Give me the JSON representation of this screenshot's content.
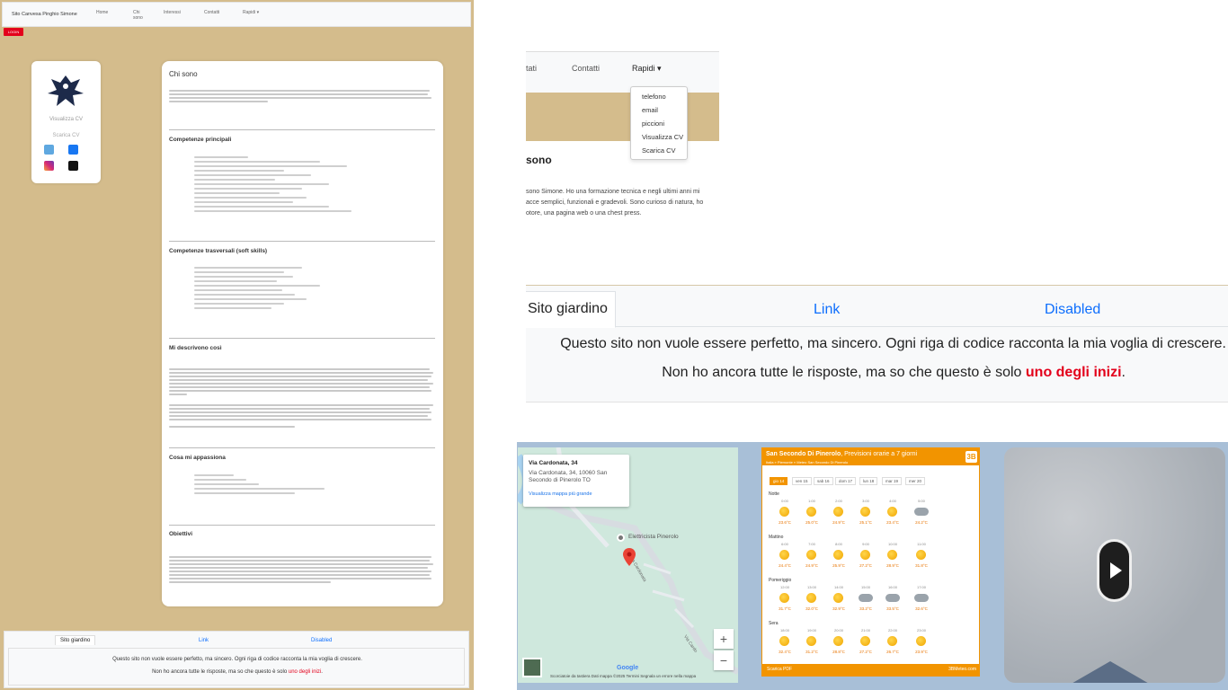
{
  "thumb": {
    "nav": {
      "brand": "Sito Canvesa Pinghio Simone",
      "links": [
        "Home",
        "Chi sono",
        "Interessi",
        "Contatti",
        "Rapidi ▾"
      ]
    },
    "red_button": "LOGIN",
    "profile": {
      "caption": "Visualizza CV",
      "download": "Scarica CV"
    },
    "main": {
      "sections": [
        "Chi sono",
        "Competenze principali",
        "Competenze trasversali (soft skills)",
        "Mi descrivono così",
        "Cosa mi appassiona",
        "Obiettivi"
      ]
    },
    "footer": {
      "tabs": [
        "Sito giardino",
        "Link",
        "Disabled"
      ],
      "line1": "Questo sito non vuole essere perfetto, ma sincero. Ogni riga di codice racconta la mia voglia di crescere.",
      "line2_prefix": "Non ho ancora tutte le risposte, ma so che questo è solo ",
      "line2_highlight": "uno degli inizi",
      "line2_suffix": "."
    }
  },
  "nav_zoom": {
    "items": [
      "tati",
      "Contatti",
      "Rapidi ▾"
    ],
    "dropdown": [
      "telefono",
      "email",
      "piccioni",
      "Visualizza CV",
      "Scarica CV"
    ],
    "heading": "sono",
    "para": [
      "sono Simone. Ho una formazione tecnica e negli ultimi anni mi",
      "acce semplici, funzionali e gradevoli. Sono curioso di natura, ho",
      "otore, una pagina web o una chest press."
    ]
  },
  "footer_zoom": {
    "tab_active": "Sito giardino",
    "tab_link": "Link",
    "tab_disabled": "Disabled",
    "line1": "Questo sito non vuole essere perfetto, ma sincero. Ogni riga di codice racconta la mia voglia di crescere.",
    "line2_prefix": "Non ho ancora tutte le risposte, ma so che questo è solo ",
    "line2_highlight": "uno degli inizi",
    "line2_suffix": "."
  },
  "map": {
    "title": "Via Cardonata, 34",
    "address1": "Via Cardonata, 34, 10060 San",
    "address2": "Secondo di Pinerolo TO",
    "link": "Visualizza mappa più grande",
    "poi": "Elettricista Pinerolo",
    "road1": "Via Cardonata",
    "road2": "Via Cardo",
    "zoom_in": "+",
    "zoom_out": "−",
    "google": "Google",
    "attribution": "Scorciatoie da tastiera   Dati mappa ©2025   Termini   Segnala un errore nella mappa"
  },
  "weather": {
    "title": "San Secondo Di Pinerolo",
    "subtitle": "Previsioni orarie a 7 giorni",
    "breadcrumb": "Italia  »  Piemonte  »  Meteo San Secondo Di Pinerolo",
    "logo": "3B",
    "days": [
      "gio 14",
      "ven 15",
      "sab 16",
      "dom 17",
      "lun 18",
      "mar 19",
      "mer 20"
    ],
    "bands": [
      {
        "name": "Notte",
        "hours": [
          "0:00",
          "1:00",
          "2:00",
          "3:00",
          "4:00",
          "5:00"
        ],
        "temps": [
          "23.6°C",
          "25.0°C",
          "24.9°C",
          "25.1°C",
          "23.4°C",
          "24.2°C"
        ],
        "icons": [
          "sun",
          "sun",
          "sun",
          "sun",
          "sun",
          "cloud"
        ]
      },
      {
        "name": "Mattino",
        "hours": [
          "6:00",
          "7:00",
          "8:00",
          "9:00",
          "10:00",
          "11:00"
        ],
        "temps": [
          "24.4°C",
          "24.9°C",
          "25.9°C",
          "27.2°C",
          "28.9°C",
          "31.8°C"
        ],
        "icons": [
          "sun",
          "sun",
          "sun",
          "sun",
          "sun",
          "sun"
        ]
      },
      {
        "name": "Pomeriggio",
        "hours": [
          "12:00",
          "13:00",
          "14:00",
          "15:00",
          "16:00",
          "17:00"
        ],
        "temps": [
          "31.7°C",
          "32.0°C",
          "32.9°C",
          "33.2°C",
          "33.5°C",
          "32.6°C"
        ],
        "icons": [
          "sun",
          "sun",
          "sun",
          "cloud",
          "cloud",
          "cloud"
        ]
      },
      {
        "name": "Sera",
        "hours": [
          "18:00",
          "19:00",
          "20:00",
          "21:00",
          "22:00",
          "23:00"
        ],
        "temps": [
          "32.4°C",
          "31.2°C",
          "28.8°C",
          "27.2°C",
          "26.7°C",
          "23.9°C"
        ],
        "icons": [
          "sun",
          "sun",
          "sun",
          "sun",
          "sun",
          "sun"
        ]
      }
    ],
    "footer_left": "Scarica PDF",
    "footer_right": "3BMeteo.com"
  }
}
